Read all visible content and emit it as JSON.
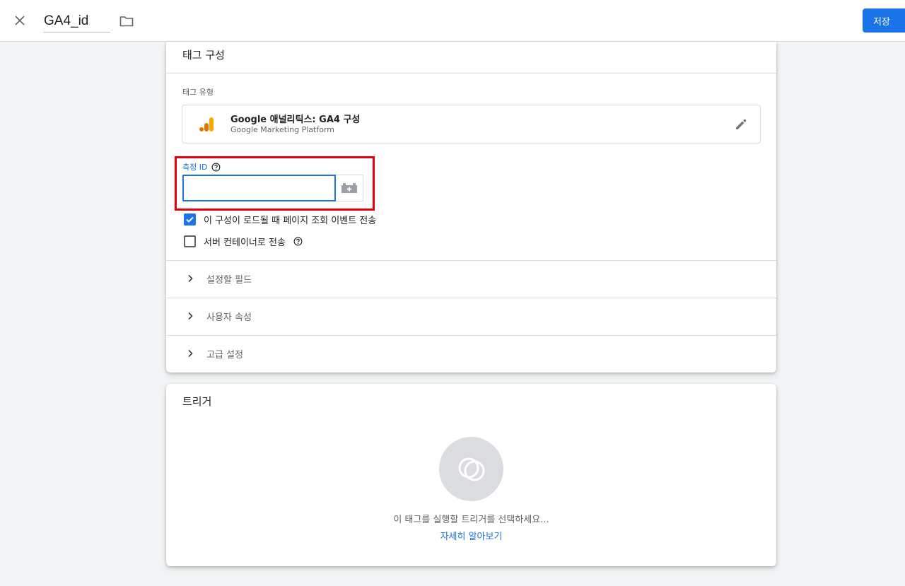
{
  "header": {
    "tag_name": "GA4_id",
    "save_label": "저장"
  },
  "config": {
    "title": "태그 구성",
    "tag_type_label": "태그 유형",
    "tag_type": {
      "name": "Google 애널리틱스: GA4 구성",
      "platform": "Google Marketing Platform"
    },
    "measurement_id": {
      "label": "측정 ID",
      "value": ""
    },
    "checkboxes": [
      {
        "label": "이 구성이 로드될 때 페이지 조회 이벤트 전송",
        "checked": true
      },
      {
        "label": "서버 컨테이너로 전송",
        "checked": false
      }
    ],
    "sections": [
      {
        "label": "설정할 필드"
      },
      {
        "label": "사용자 속성"
      },
      {
        "label": "고급 설정"
      }
    ]
  },
  "trigger": {
    "title": "트리거",
    "prompt": "이 태그를 실행할 트리거를 선택하세요...",
    "learn_more": "자세히 알아보기"
  },
  "colors": {
    "accent": "#1a73e8",
    "highlight": "#e8000b",
    "ga_orange": "#f9ab00",
    "ga_dark_orange": "#e37400"
  }
}
